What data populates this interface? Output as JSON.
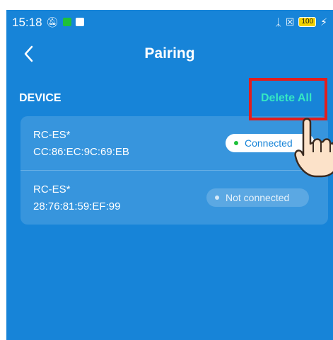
{
  "status_bar": {
    "time": "15:18",
    "battery": "100",
    "icons": [
      "mute-vibrate-icon",
      "green-app-icon",
      "notification-icon",
      "bluetooth-icon",
      "sim-x-icon",
      "battery-icon",
      "charging-icon"
    ]
  },
  "header": {
    "title": "Pairing",
    "back_icon": "chevron-left-icon"
  },
  "section": {
    "label": "DEVICE",
    "delete_all": "Delete All"
  },
  "devices": [
    {
      "name": "RC-ES*",
      "mac": "CC:86:EC:9C:69:EB",
      "status": "Connected",
      "status_color": "#1ec13a"
    },
    {
      "name": "RC-ES*",
      "mac": "28:76:81:59:EF:99",
      "status": "Not connected",
      "status_color": "#bcd9f2"
    }
  ],
  "colors": {
    "background": "#1784d8",
    "accent": "#35e8c3",
    "highlight": "#e01e1e"
  }
}
